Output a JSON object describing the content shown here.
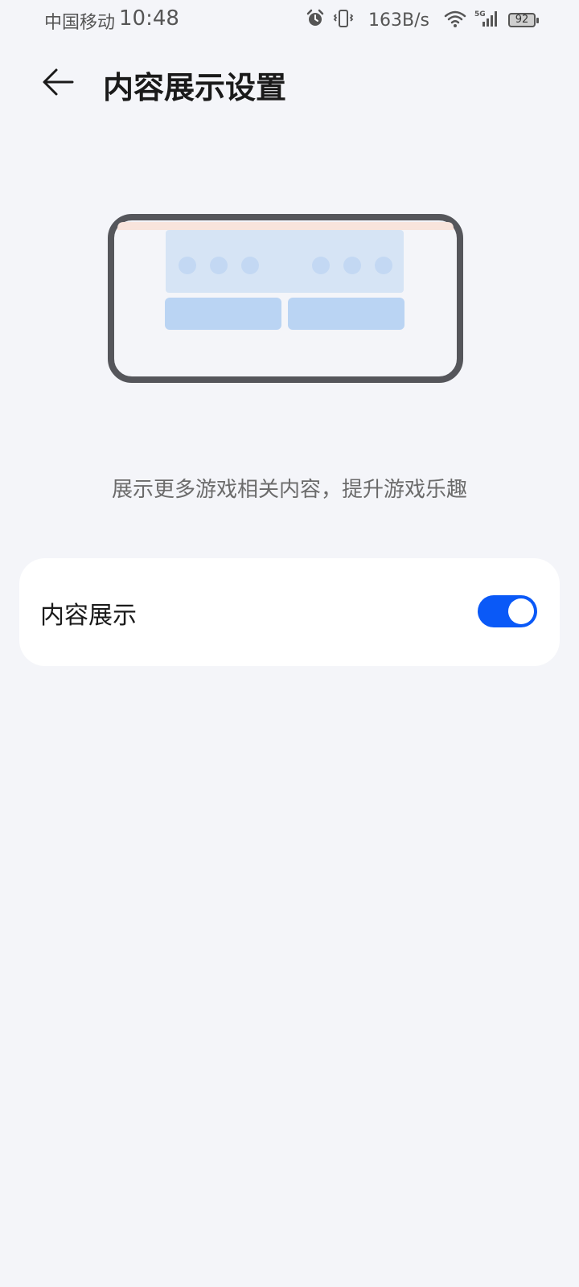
{
  "status_bar": {
    "carrier": "中国移动",
    "time": "10:48",
    "net_speed": "163B/s",
    "battery": "92",
    "icons": [
      "alarm-icon",
      "vibrate-icon",
      "wifi-icon",
      "5g-signal-icon",
      "battery-icon"
    ]
  },
  "header": {
    "title": "内容展示设置",
    "back_icon": "arrow-left-icon"
  },
  "illustration": {
    "frame_color": "#55565b",
    "top_bar_color": "#f8e4dc",
    "panel_color": "#d6e4f5",
    "button_color": "#bad4f3",
    "dot_color": "#c3d8f3"
  },
  "description": "展示更多游戏相关内容，提升游戏乐趣",
  "setting": {
    "label": "内容展示",
    "enabled": true,
    "accent": "#0a59f7"
  }
}
